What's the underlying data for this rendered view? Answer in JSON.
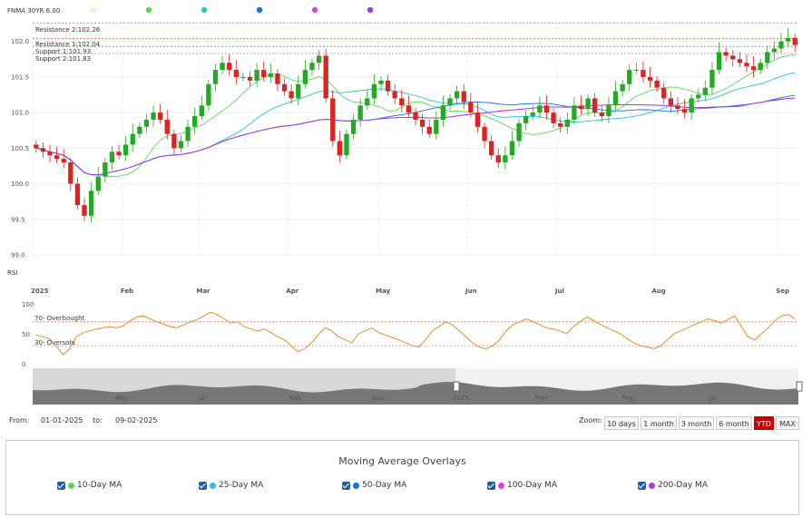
{
  "chart_data": {
    "type": "candlestick",
    "title": "FNMA 30YR 6.00",
    "legend_dot_colors": [
      "#e8f5d0",
      "#5cd65c",
      "#22c4e0",
      "#1a6fe0",
      "#e040e0",
      "#9a40e0"
    ],
    "price_axis": {
      "ticks": [
        "99.0",
        "99.5",
        "100.0",
        "100.5",
        "101.0",
        "101.5",
        "102.0"
      ],
      "min": 99.0,
      "max": 102.2
    },
    "levels": [
      {
        "label": "Resistance 2:102.26",
        "value": 102.26,
        "color": "#e07060"
      },
      {
        "label": "Resistance 1:102.04",
        "value": 102.04,
        "color": "#e07060"
      },
      {
        "label": "Support 1:101.93",
        "value": 101.93,
        "color": "#888888"
      },
      {
        "label": "Support 2:101.83",
        "value": 101.83,
        "color": "#888888"
      }
    ],
    "month_labels": [
      "2025",
      "Feb",
      "Mar",
      "Apr",
      "May",
      "Jun",
      "Jul",
      "Aug",
      "Sep"
    ],
    "close_series": [
      100.5,
      100.45,
      100.4,
      100.35,
      100.3,
      100.0,
      99.7,
      99.55,
      99.9,
      100.1,
      100.3,
      100.45,
      100.4,
      100.55,
      100.7,
      100.8,
      100.9,
      101.0,
      100.9,
      100.7,
      100.5,
      100.6,
      100.8,
      100.95,
      101.1,
      101.4,
      101.6,
      101.7,
      101.6,
      101.5,
      101.5,
      101.45,
      101.6,
      101.5,
      101.55,
      101.4,
      101.3,
      101.2,
      101.4,
      101.6,
      101.7,
      101.8,
      101.2,
      100.6,
      100.4,
      100.7,
      100.9,
      101.1,
      101.2,
      101.4,
      101.45,
      101.3,
      101.2,
      101.1,
      101.0,
      100.9,
      100.8,
      100.7,
      100.9,
      101.1,
      101.2,
      101.3,
      101.15,
      101.0,
      100.8,
      100.6,
      100.4,
      100.3,
      100.4,
      100.6,
      100.85,
      100.95,
      101.0,
      101.1,
      101.0,
      100.85,
      100.8,
      100.9,
      101.1,
      101.05,
      101.2,
      101.0,
      100.95,
      101.1,
      101.3,
      101.4,
      101.6,
      101.6,
      101.5,
      101.45,
      101.35,
      101.2,
      101.1,
      101.05,
      101.0,
      101.2,
      101.25,
      101.35,
      101.6,
      101.85,
      101.8,
      101.75,
      101.7,
      101.65,
      101.6,
      101.7,
      101.85,
      101.9,
      102.0,
      102.05,
      101.95
    ]
  },
  "rsi": {
    "label": "RSI",
    "ticks": [
      "0",
      "50",
      "100"
    ],
    "overbought_label": "70- Overbought",
    "oversold_label": "30- Oversold",
    "values": [
      48,
      45,
      42,
      30,
      15,
      25,
      45,
      52,
      55,
      58,
      60,
      62,
      60,
      63,
      72,
      78,
      80,
      75,
      70,
      66,
      62,
      60,
      65,
      70,
      74,
      80,
      86,
      82,
      75,
      68,
      70,
      62,
      58,
      55,
      58,
      52,
      45,
      40,
      30,
      20,
      25,
      35,
      48,
      60,
      55,
      45,
      40,
      35,
      50,
      55,
      60,
      52,
      48,
      44,
      40,
      35,
      30,
      28,
      40,
      55,
      62,
      70,
      65,
      55,
      45,
      35,
      28,
      25,
      30,
      40,
      55,
      65,
      70,
      75,
      70,
      65,
      60,
      58,
      55,
      50,
      62,
      70,
      78,
      72,
      66,
      60,
      55,
      50,
      42,
      35,
      30,
      28,
      25,
      30,
      40,
      50,
      55,
      60,
      65,
      70,
      75,
      72,
      68,
      74,
      80,
      62,
      45,
      40,
      50,
      60,
      72,
      80,
      82,
      75
    ]
  },
  "navigator": {
    "labels": [
      "May",
      "Jul",
      "Sep",
      "Nov",
      "2025",
      "Mar",
      "May",
      "Jul"
    ]
  },
  "range": {
    "from_label": "From:",
    "from_value": "01-01-2025",
    "to_label": "to:",
    "to_value": "09-02-2025",
    "zoom_label": "Zoom:",
    "buttons": [
      "10 days",
      "1 month",
      "3 month",
      "6 month",
      "YTD",
      "MAX"
    ],
    "active": "YTD"
  },
  "overlays": {
    "title": "Moving Average Overlays",
    "items": [
      {
        "label": "10-Day MA",
        "color": "#5cd65c"
      },
      {
        "label": "25-Day MA",
        "color": "#22c4e0"
      },
      {
        "label": "50-Day MA",
        "color": "#1a6fe0"
      },
      {
        "label": "100-Day MA",
        "color": "#e040e0"
      },
      {
        "label": "200-Day MA",
        "color": "#9a40e0"
      }
    ]
  }
}
